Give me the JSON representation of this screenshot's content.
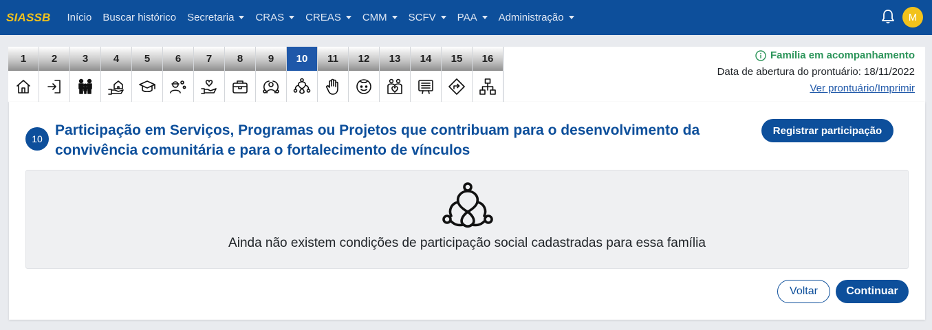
{
  "navbar": {
    "brand": "SIASSB",
    "items": [
      {
        "label": "Início",
        "dropdown": false
      },
      {
        "label": "Buscar histórico",
        "dropdown": false
      },
      {
        "label": "Secretaria",
        "dropdown": true
      },
      {
        "label": "CRAS",
        "dropdown": true
      },
      {
        "label": "CREAS",
        "dropdown": true
      },
      {
        "label": "CMM",
        "dropdown": true
      },
      {
        "label": "SCFV",
        "dropdown": true
      },
      {
        "label": "PAA",
        "dropdown": true
      },
      {
        "label": "Administração",
        "dropdown": true
      }
    ],
    "avatar_initial": "M",
    "brand_color": "#0d4f9b",
    "accent_color": "#f2c21b"
  },
  "steps": [
    {
      "num": "1",
      "icon": "home-icon"
    },
    {
      "num": "2",
      "icon": "sign-in-icon"
    },
    {
      "num": "3",
      "icon": "family-icon"
    },
    {
      "num": "4",
      "icon": "hand-house-icon"
    },
    {
      "num": "5",
      "icon": "graduation-cap-icon"
    },
    {
      "num": "6",
      "icon": "worker-gear-icon"
    },
    {
      "num": "7",
      "icon": "hand-heart-icon"
    },
    {
      "num": "8",
      "icon": "briefcase-icon"
    },
    {
      "num": "9",
      "icon": "people-heart-icon"
    },
    {
      "num": "10",
      "icon": "community-bond-icon",
      "active": true
    },
    {
      "num": "11",
      "icon": "stop-hand-icon"
    },
    {
      "num": "12",
      "icon": "child-face-icon"
    },
    {
      "num": "13",
      "icon": "group-heart-icon"
    },
    {
      "num": "14",
      "icon": "presentation-board-icon"
    },
    {
      "num": "15",
      "icon": "route-sign-icon"
    },
    {
      "num": "16",
      "icon": "org-chart-icon"
    }
  ],
  "info": {
    "status": "Família em acompanhamento",
    "opened": "Data de abertura do prontuário: 18/11/2022",
    "print_link": "Ver prontuário/Imprimir"
  },
  "section": {
    "badge": "10",
    "title": "Participação em Serviços, Programas ou Projetos que contribuam para o desenvolvimento da convivência comunitária e para o fortalecimento de vínculos",
    "register_button": "Registrar participação",
    "empty_message": "Ainda não existem condições de participação social cadastradas para essa família",
    "back_button": "Voltar",
    "continue_button": "Continuar"
  }
}
